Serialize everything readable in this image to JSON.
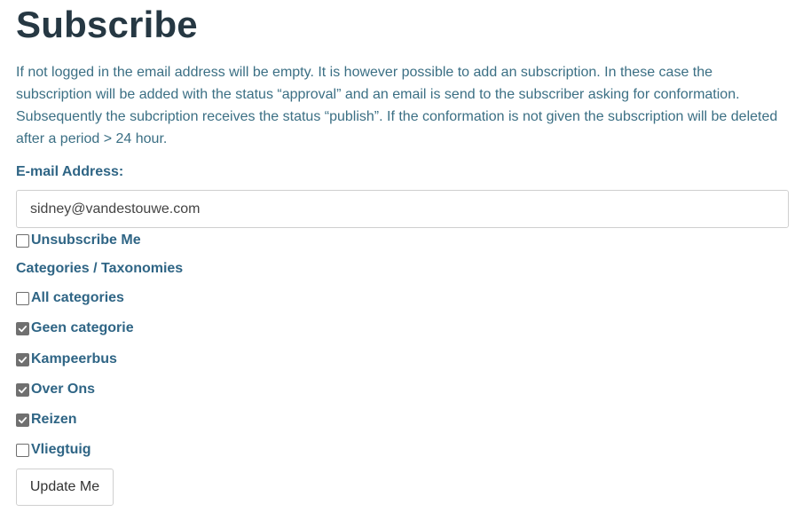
{
  "page": {
    "title": "Subscribe",
    "intro": "If not logged in the email address will be empty. It is however possible to add an subscription. In these case the subscription will be added with the status “approval” and an email is send to the subscriber asking for conformation. Subsequently the subcription receives the status “publish”. If the conformation is not given the subscription will be deleted after a period > 24 hour."
  },
  "form": {
    "email_label": "E-mail Address:",
    "email_value": "sidney@vandestouwe.com",
    "unsubscribe": {
      "label": "Unsubscribe Me",
      "checked": false
    },
    "categories_label": "Categories / Taxonomies",
    "categories": [
      {
        "label": "All categories",
        "checked": false
      },
      {
        "label": "Geen categorie",
        "checked": true
      },
      {
        "label": "Kampeerbus",
        "checked": true
      },
      {
        "label": "Over Ons",
        "checked": true
      },
      {
        "label": "Reizen",
        "checked": true
      },
      {
        "label": "Vliegtuig",
        "checked": false
      }
    ],
    "submit_label": "Update Me"
  },
  "colors": {
    "heading": "#263843",
    "body_text": "#3b6f84",
    "label": "#2f6585",
    "checkbox_checked": "#707070"
  }
}
